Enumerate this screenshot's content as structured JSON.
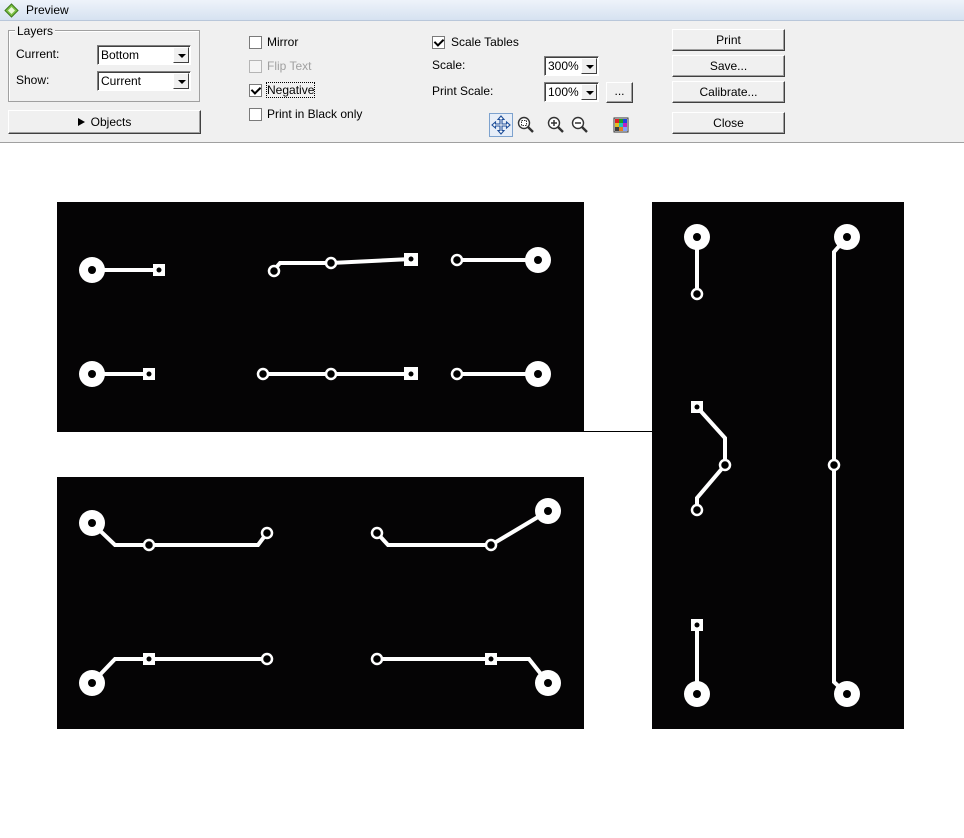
{
  "window": {
    "title": "Preview"
  },
  "layers": {
    "legend": "Layers",
    "current_label": "Current:",
    "current_value": "Bottom",
    "show_label": "Show:",
    "show_value": "Current"
  },
  "objects_button": "Objects",
  "options": {
    "mirror": {
      "label": "Mirror",
      "checked": false
    },
    "flip_text": {
      "label": "Flip Text",
      "checked": false,
      "disabled": true
    },
    "negative": {
      "label": "Negative",
      "checked": true
    },
    "black_only": {
      "label": "Print in Black only",
      "checked": false
    }
  },
  "scale": {
    "scale_tables_label": "Scale Tables",
    "scale_tables_checked": true,
    "scale_label": "Scale:",
    "scale_value": "300%",
    "print_scale_label": "Print Scale:",
    "print_scale_value": "100%",
    "ellipsis_button": "..."
  },
  "actions": {
    "print": "Print",
    "save": "Save...",
    "calibrate": "Calibrate...",
    "close": "Close"
  },
  "view_tools": [
    "move-icon",
    "zoom-window-icon",
    "zoom-in-icon",
    "zoom-out-icon",
    "color-palette-icon"
  ],
  "colors": {
    "board": "#050405",
    "copper": "#ffffff",
    "toolbar_bg": "#f0f0f0",
    "titlebar": "#d6e2f1"
  }
}
